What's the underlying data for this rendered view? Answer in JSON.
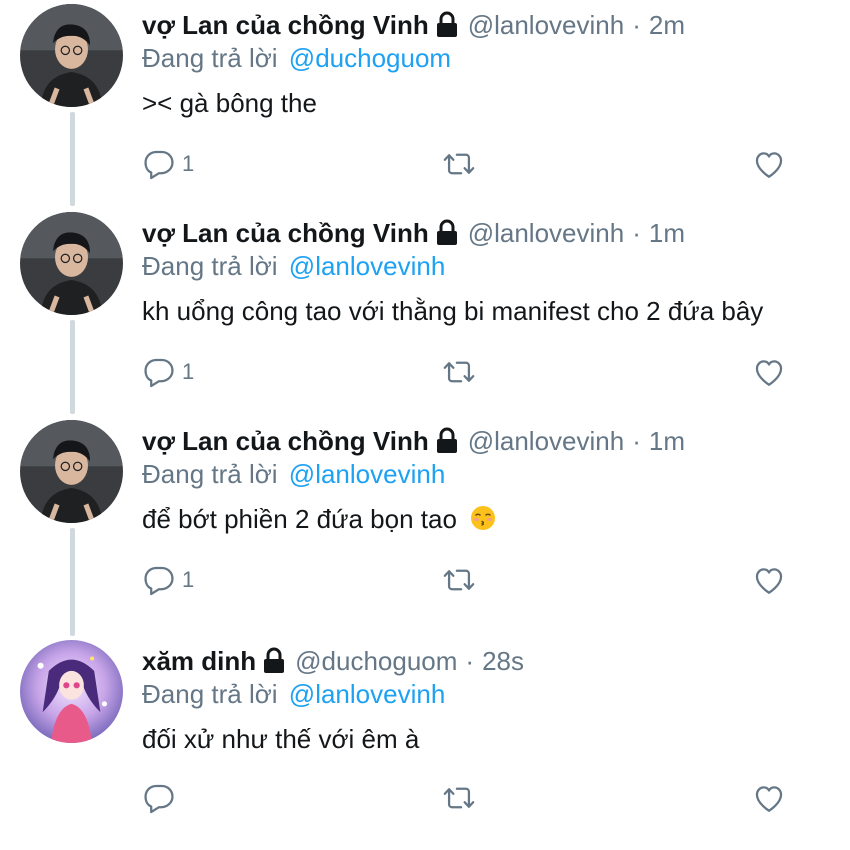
{
  "tweets": [
    {
      "name": "vợ Lan của chồng Vinh",
      "handle": "@lanlovevinh",
      "time": "2m",
      "reply_prefix": "Đang trả lời",
      "reply_to": "@duchoguom",
      "text": ">< gà bông the",
      "reply_count": "1",
      "avatar": "avatar-boy",
      "has_emoji": false
    },
    {
      "name": "vợ Lan của chồng Vinh",
      "handle": "@lanlovevinh",
      "time": "1m",
      "reply_prefix": "Đang trả lời",
      "reply_to": "@lanlovevinh",
      "text": "kh uổng công tao với thằng bi manifest cho 2 đứa bây",
      "reply_count": "1",
      "avatar": "avatar-boy",
      "has_emoji": false
    },
    {
      "name": "vợ Lan của chồng Vinh",
      "handle": "@lanlovevinh",
      "time": "1m",
      "reply_prefix": "Đang trả lời",
      "reply_to": "@lanlovevinh",
      "text": "để bớt phiền 2 đứa bọn tao",
      "reply_count": "1",
      "avatar": "avatar-boy",
      "has_emoji": true,
      "emoji": "kissing-face-emoji"
    },
    {
      "name": "xăm dinh",
      "handle": "@duchoguom",
      "time": "28s",
      "reply_prefix": "Đang trả lời",
      "reply_to": "@lanlovevinh",
      "text": "đối xử như thế với êm à",
      "reply_count": "",
      "avatar": "avatar-anime",
      "has_emoji": false
    }
  ],
  "icons": {
    "lock": "lock-icon",
    "reply": "reply-icon",
    "retweet": "retweet-icon",
    "like": "like-icon"
  },
  "colors": {
    "name": "#14171a",
    "secondary": "#657786",
    "mention": "#1da1f2",
    "thread_line": "#cfd9de"
  },
  "separator": "·"
}
